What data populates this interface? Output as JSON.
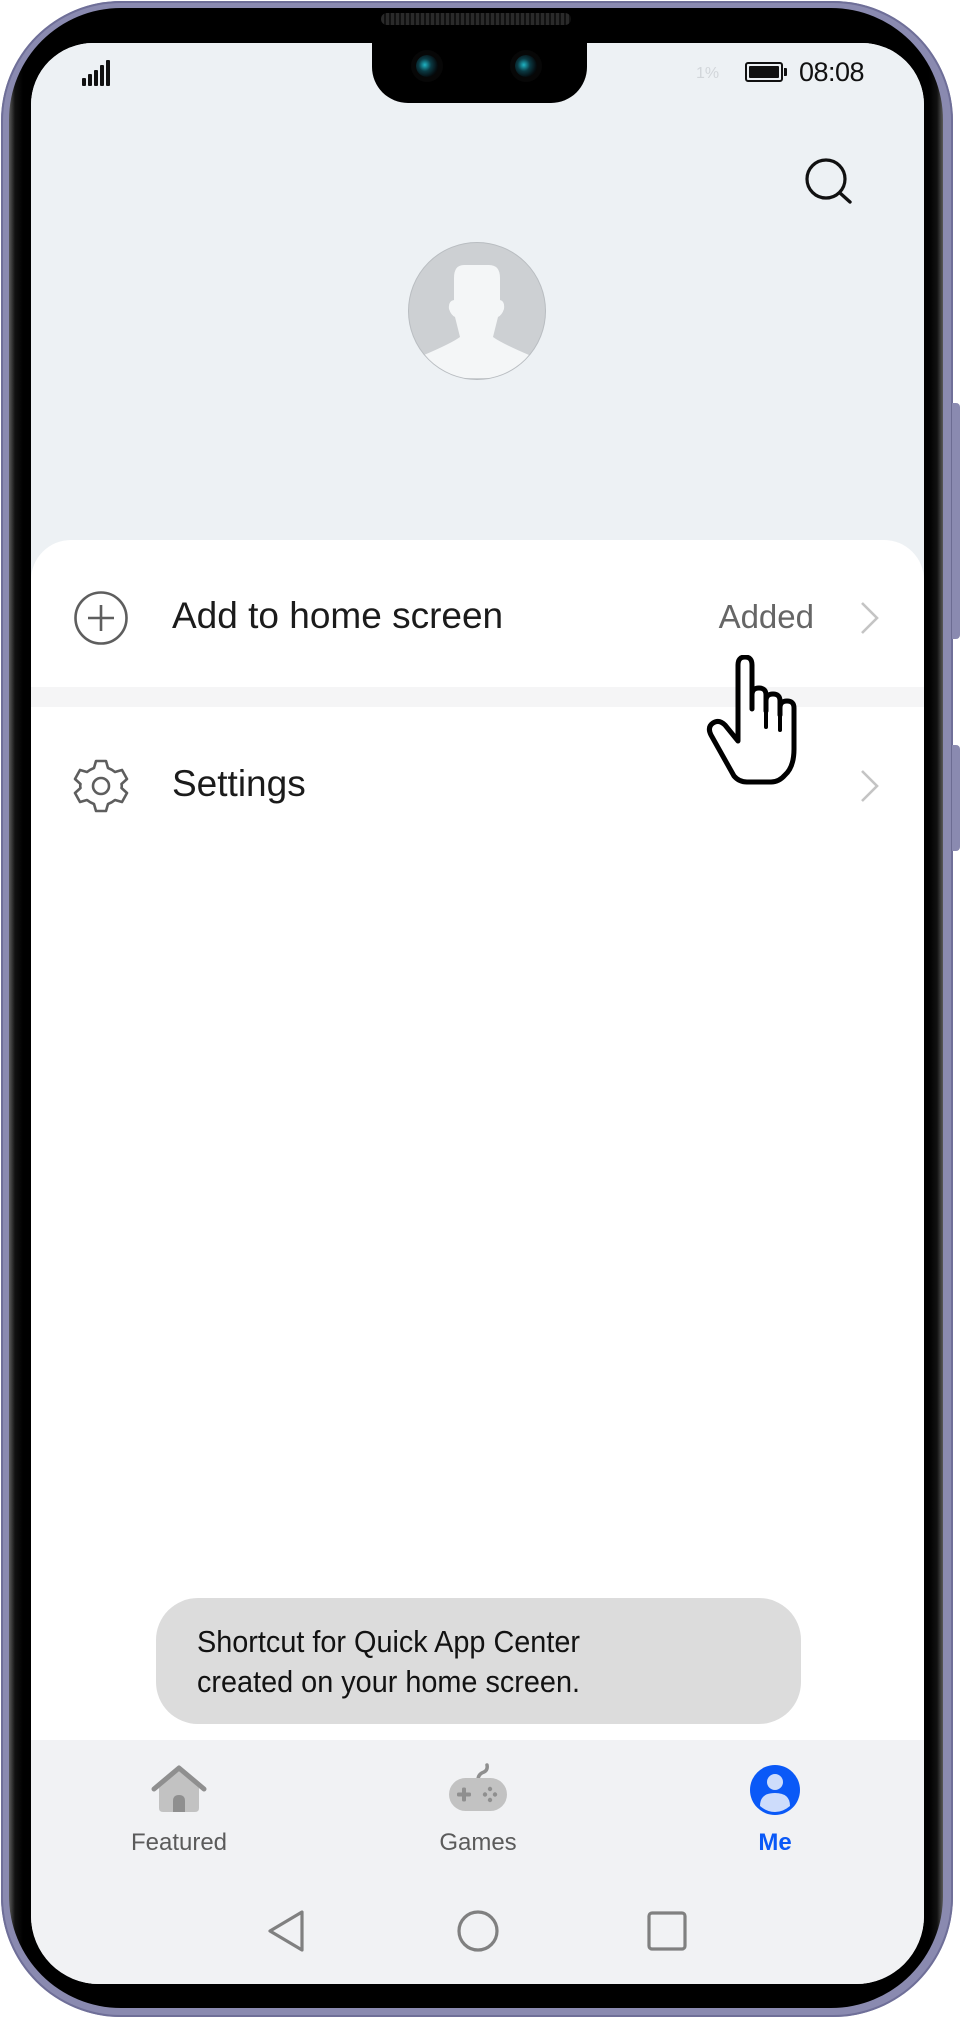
{
  "status_bar": {
    "signal_icon": "signal-strength-icon",
    "battery_ghost_text": "1%",
    "battery_icon": "battery-full-icon",
    "time": "08:08"
  },
  "header": {
    "search_icon": "search-icon",
    "avatar_icon": "default-user-avatar"
  },
  "menu": {
    "items": [
      {
        "icon": "add-circle-icon",
        "label": "Add to home screen",
        "value": "Added",
        "chevron": "chevron-right-icon"
      },
      {
        "icon": "gear-icon",
        "label": "Settings",
        "value": "",
        "chevron": "chevron-right-icon"
      }
    ]
  },
  "toast": {
    "lines": [
      "Shortcut for Quick App Center",
      "created on your home screen."
    ]
  },
  "bottom_nav": {
    "tabs": [
      {
        "label": "Featured",
        "icon": "home-icon",
        "active": false
      },
      {
        "label": "Games",
        "icon": "gamepad-icon",
        "active": false
      },
      {
        "label": "Me",
        "icon": "user-circle-icon",
        "active": true
      }
    ],
    "active_color": "#0a59f7",
    "inactive_color": "#5b5b5b"
  },
  "system_nav": {
    "buttons": [
      "back-icon",
      "home-circle-icon",
      "recents-square-icon"
    ]
  },
  "overlay": {
    "pointer": "hand-pointer-cursor"
  },
  "colors": {
    "header_bg": "#edf1f4",
    "card_bg": "#ffffff",
    "nav_bg": "#f1f2f4",
    "toast_bg": "#dcdcdc",
    "frame": "#8a8ab0"
  }
}
